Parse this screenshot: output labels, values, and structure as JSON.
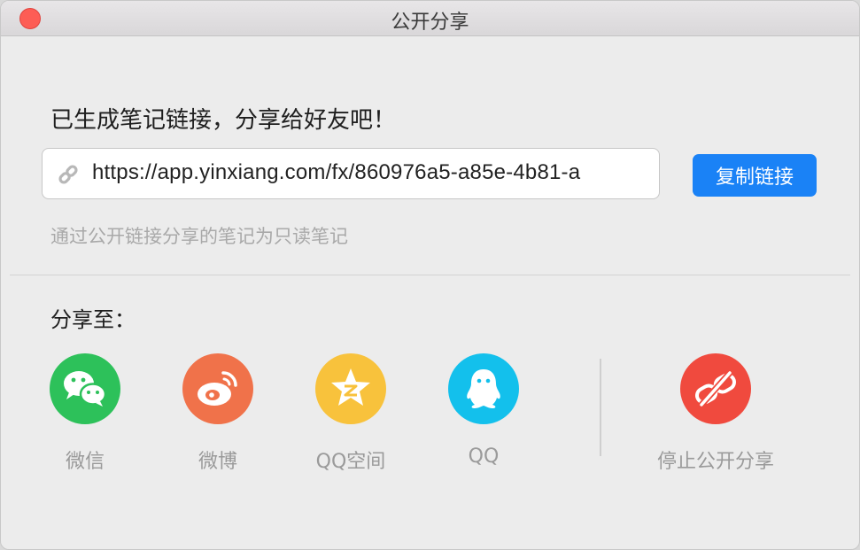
{
  "window": {
    "title": "公开分享"
  },
  "heading": "已生成笔记链接，分享给好友吧！",
  "link": {
    "url": "https://app.yinxiang.com/fx/860976a5-a85e-4b81-a"
  },
  "copy_button": "复制链接",
  "note": "通过公开链接分享的笔记为只读笔记",
  "share_to": "分享至：",
  "share_targets": [
    {
      "label": "微信",
      "icon": "wechat-icon",
      "color": "#2dc15a"
    },
    {
      "label": "微博",
      "icon": "weibo-icon",
      "color": "#f0724a"
    },
    {
      "label": "QQ空间",
      "icon": "qzone-icon",
      "color": "#f8c23c"
    },
    {
      "label": "QQ",
      "icon": "qq-icon",
      "color": "#13c0ec"
    }
  ],
  "stop_share": {
    "label": "停止公开分享",
    "icon": "unlink-icon",
    "color": "#f04a3e"
  },
  "colors": {
    "accent": "#1a82f6"
  }
}
